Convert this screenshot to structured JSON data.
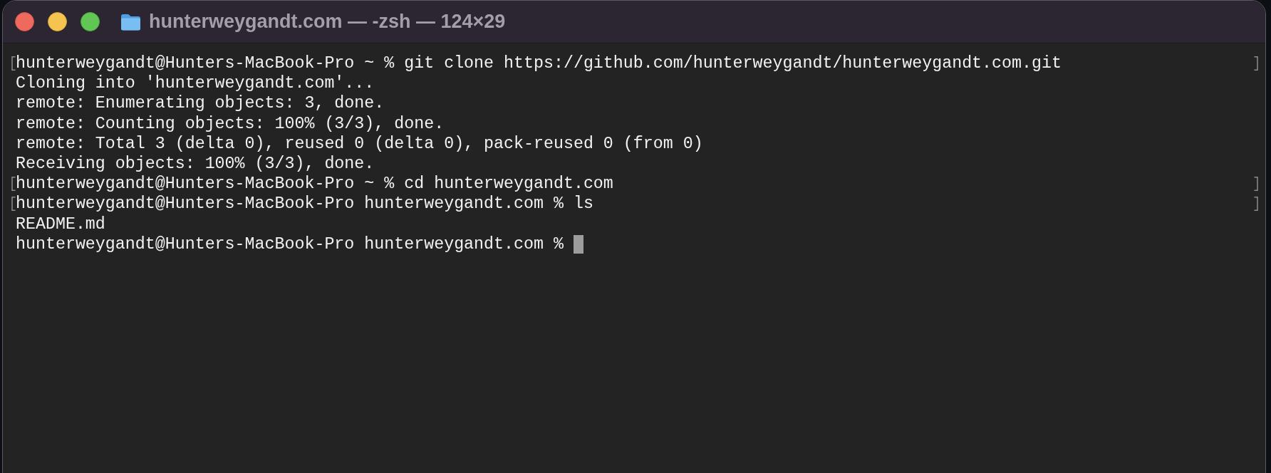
{
  "window": {
    "title": "hunterweygandt.com — -zsh — 124×29"
  },
  "terminal": {
    "lines": [
      {
        "text": "hunterweygandt@Hunters-MacBook-Pro ~ % git clone https://github.com/hunterweygandt/hunterweygandt.com.git",
        "marked": true,
        "cursor": false
      },
      {
        "text": "Cloning into 'hunterweygandt.com'...",
        "marked": false,
        "cursor": false
      },
      {
        "text": "remote: Enumerating objects: 3, done.",
        "marked": false,
        "cursor": false
      },
      {
        "text": "remote: Counting objects: 100% (3/3), done.",
        "marked": false,
        "cursor": false
      },
      {
        "text": "remote: Total 3 (delta 0), reused 0 (delta 0), pack-reused 0 (from 0)",
        "marked": false,
        "cursor": false
      },
      {
        "text": "Receiving objects: 100% (3/3), done.",
        "marked": false,
        "cursor": false
      },
      {
        "text": "hunterweygandt@Hunters-MacBook-Pro ~ % cd hunterweygandt.com",
        "marked": true,
        "cursor": false
      },
      {
        "text": "hunterweygandt@Hunters-MacBook-Pro hunterweygandt.com % ls",
        "marked": true,
        "cursor": false
      },
      {
        "text": "README.md",
        "marked": false,
        "cursor": false
      },
      {
        "text": "hunterweygandt@Hunters-MacBook-Pro hunterweygandt.com %",
        "marked": false,
        "cursor": true
      }
    ]
  }
}
